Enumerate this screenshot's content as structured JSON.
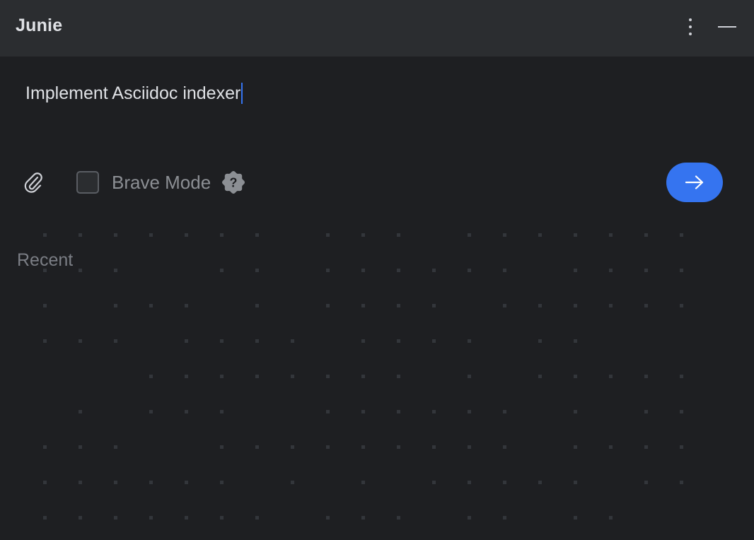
{
  "titlebar": {
    "title": "Junie",
    "more_icon": "vertical-ellipsis-icon",
    "minimize_icon": "minimize-icon"
  },
  "prompt": {
    "value": "Implement Asciidoc indexer"
  },
  "toolbar": {
    "attach_icon": "paperclip-icon",
    "brave_mode_label": "Brave Mode",
    "brave_mode_checked": false,
    "help_icon": "question-badge-icon",
    "send_icon": "arrow-right-icon"
  },
  "recent": {
    "heading": "Recent"
  },
  "colors": {
    "background": "#1e1f22",
    "titlebar": "#2b2d30",
    "accent": "#3574f0",
    "text_primary": "#dfe1e5",
    "text_muted": "#8c8f94"
  }
}
